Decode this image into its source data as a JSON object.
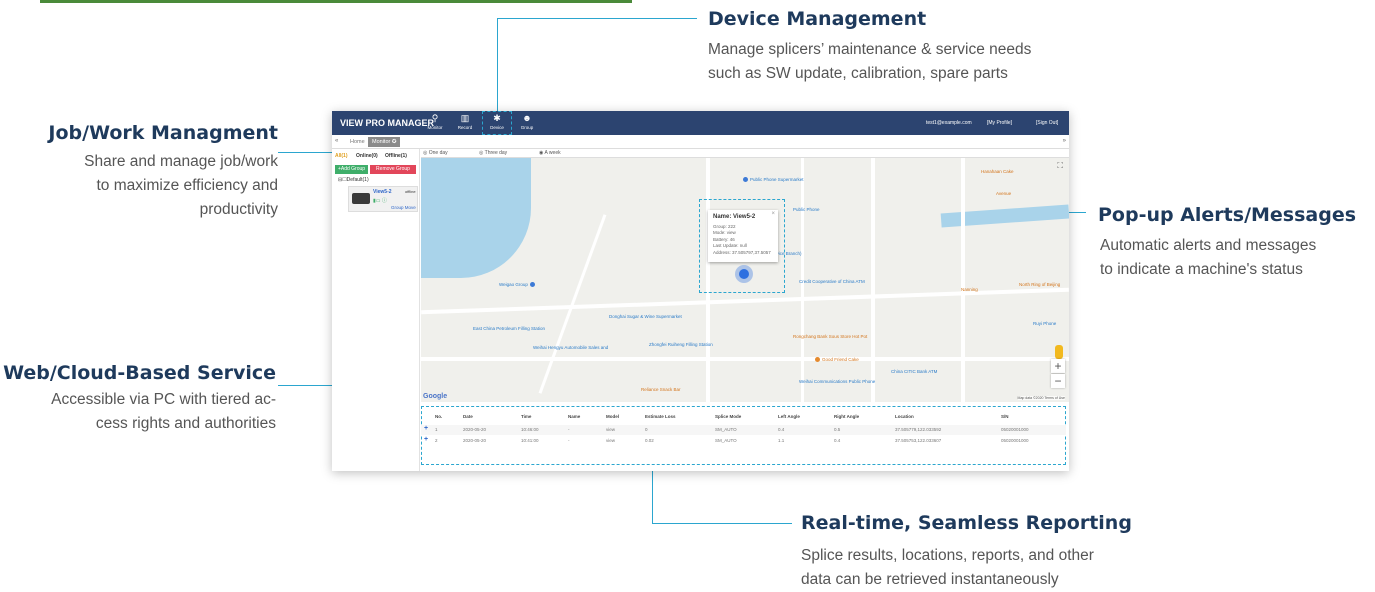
{
  "callouts": {
    "device": {
      "title": "Device Management",
      "lines": [
        "Manage splicers’ maintenance & service needs",
        "such as SW update, calibration, spare parts"
      ]
    },
    "job": {
      "title": "Job/Work Managment",
      "lines": [
        "Share and manage job/work",
        "to maximize efficiency and",
        "productivity"
      ]
    },
    "popup": {
      "title": "Pop-up Alerts/Messages",
      "lines": [
        "Automatic alerts and messages",
        "to indicate a machine's status"
      ]
    },
    "web": {
      "title": "Web/Cloud-Based Service",
      "lines": [
        "Accessible via PC with tiered ac-",
        "cess rights and authorities"
      ]
    },
    "report": {
      "title": "Real-time, Seamless Reporting",
      "lines": [
        "Splice results, locations, reports, and other",
        "data can be retrieved instantaneously"
      ]
    }
  },
  "app": {
    "title": "VIEW PRO MANAGER",
    "nav": [
      {
        "label": "Monitor",
        "icon": "map-pin-icon",
        "glyph": "⚲"
      },
      {
        "label": "Record",
        "icon": "map-icon",
        "glyph": "▥"
      },
      {
        "label": "Device",
        "icon": "gear-icon",
        "glyph": "✱"
      },
      {
        "label": "Group",
        "icon": "user-add-icon",
        "glyph": "☻"
      }
    ],
    "user_email": "test1@example.com",
    "my_profile": "[My Profile]",
    "sign_out": "[Sign Out]",
    "tabs": [
      "Home",
      "Monitor ✪"
    ],
    "filters": {
      "all": "All(1)",
      "online": "Online(0)",
      "offline": "Offline(1)"
    },
    "add_group": "+Add Group",
    "remove_group": "Remove Group",
    "tree_group": "Default(1)",
    "device": {
      "name": "View5-2",
      "status": "offline",
      "action": "Group Move"
    },
    "time_ranges": [
      "One day",
      "Three day",
      "A week"
    ],
    "popup": {
      "name_label": "Name:",
      "name": "View5-2",
      "lines": [
        "Group:  222",
        "Mode:  view",
        "Battery:  46",
        "Last Update:  null",
        "Address:  37.505797,37.5057"
      ]
    },
    "map_labels": [
      "Public Phone Supermarket",
      "Public Phone",
      "Bank of China (Hi Road Service Branch)",
      "Credit Cooperative of China ATM",
      "Weigao Group",
      "Donghai Sugar & Wine Supermarket",
      "East China Petroleum Filling Station",
      "Weihai Hengyu Automobile Sales and",
      "Zhongfei Ruiheng Filling Station",
      "Rongchang Bank Sous Store Hot Pot",
      "Good Friend Cake",
      "China CITIC Bank ATM",
      "Weihai Communications Public Phone",
      "Reliance Snack Bar",
      "Hanahaan Cake",
      "Avenue",
      "Nanning",
      "North Ring of Beijing",
      "Ruyi Phone"
    ],
    "google": "Google",
    "map_footer": "Map data ©2020   Terms of Use",
    "table": {
      "columns": [
        "No.",
        "Date",
        "Time",
        "Name",
        "Model",
        "Estimate Loss",
        "Splice Mode",
        "Left Angle",
        "Right Angle",
        "Location",
        "S/N"
      ],
      "rows": [
        [
          "1",
          "2020-05-20",
          "10:46:00",
          "-",
          "view",
          "0",
          "SM_AUTO",
          "0.4",
          "0.5",
          "37.505779,122.033592",
          "05020001000"
        ],
        [
          "2",
          "2020-05-20",
          "10:41:00",
          "-",
          "view",
          "0.02",
          "SM_AUTO",
          "1.1",
          "0.4",
          "37.505753,122.033607",
          "05020001000"
        ]
      ]
    }
  },
  "colors": {
    "header": "#2c4470",
    "accent": "#2ba6cf",
    "title": "#1e3a5c",
    "add_btn": "#3fae6a",
    "remove_btn": "#e2465a"
  }
}
